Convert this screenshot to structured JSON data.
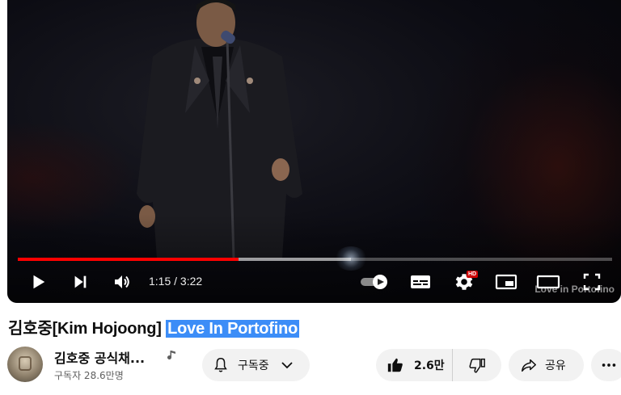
{
  "player": {
    "time_display": "1:15 / 3:22",
    "progress_played_fraction": 0.372,
    "progress_buffered_fraction": 0.56,
    "hd_badge": "HD",
    "watermark": "Love in Portofino",
    "colors": {
      "progress": "#ff0000",
      "hd_badge": "#cc0000"
    },
    "icons": [
      "play-icon",
      "next-icon",
      "volume-icon",
      "autoplay-toggle-icon",
      "subtitles-icon",
      "settings-icon",
      "miniplayer-icon",
      "theater-mode-icon",
      "fullscreen-icon"
    ]
  },
  "video": {
    "title_prefix": "김호중[Kim Hojoong] ",
    "title_highlighted": "Love In Portofino",
    "highlight_color": "#3c8df7"
  },
  "channel": {
    "name": "김호중 공식채...",
    "subscribers": "구독자 28.6만명",
    "icon": "music-note-icon"
  },
  "actions": {
    "subscribe_label": "구독중",
    "like_count": "2.6만",
    "share_label": "공유",
    "icons": [
      "bell-icon",
      "chevron-down-icon",
      "thumbs-up-icon",
      "thumbs-down-icon",
      "share-icon",
      "more-icon"
    ]
  }
}
